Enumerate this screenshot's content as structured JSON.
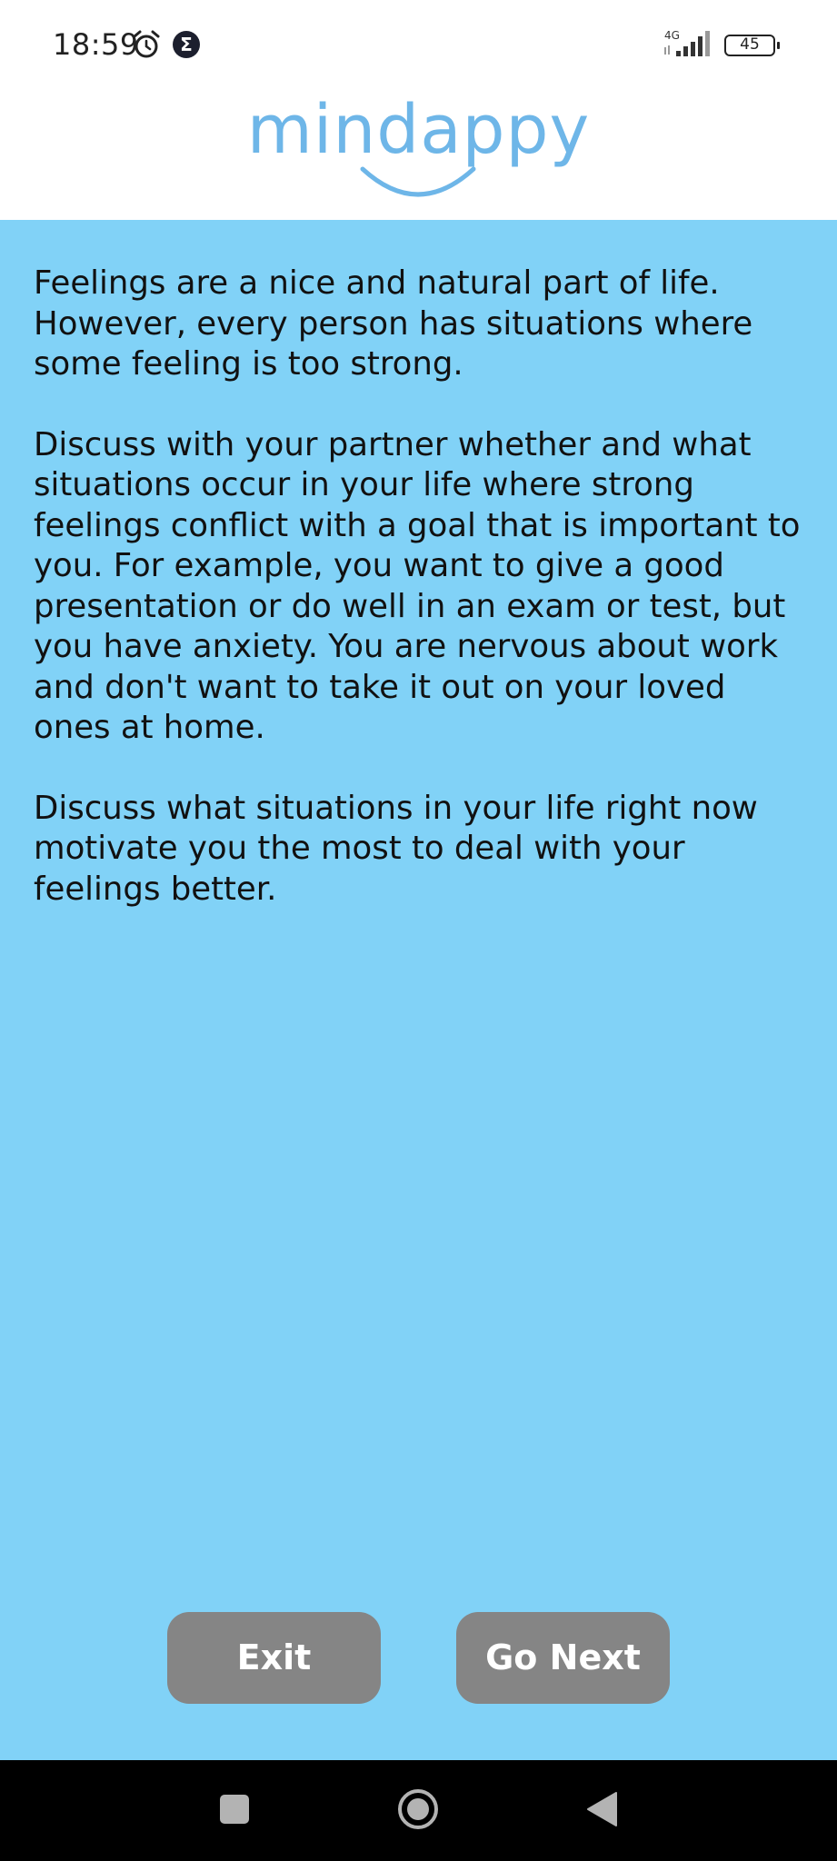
{
  "status_bar": {
    "time": "18:59",
    "network_label": "4G",
    "battery_level": "45",
    "icons": [
      "alarm-icon",
      "sigma-icon",
      "signal-icon",
      "battery-icon"
    ]
  },
  "header": {
    "logo_text": "mindappy"
  },
  "content": {
    "paragraphs": [
      "Feelings are a nice and natural part of life. However, every person has situations where some feeling is too strong.",
      "Discuss with your partner whether and what situations occur in your life where strong feelings conflict with a goal that is important to you. For example, you want to give a good presentation or do well in an exam or test, but you have anxiety. You are nervous about work and don't want to take it out on your loved ones at home.",
      "Discuss what situations in your life right now motivate you the most to deal with your feelings better."
    ]
  },
  "actions": {
    "exit_label": "Exit",
    "next_label": "Go Next"
  },
  "nav_bar": {
    "icons": [
      "recents-icon",
      "home-icon",
      "back-icon"
    ]
  },
  "colors": {
    "background": "#81d2f7",
    "header_background": "#ffffff",
    "logo": "#6eb6e8",
    "button": "#858585",
    "button_text": "#ffffff",
    "nav_bar": "#000000"
  }
}
